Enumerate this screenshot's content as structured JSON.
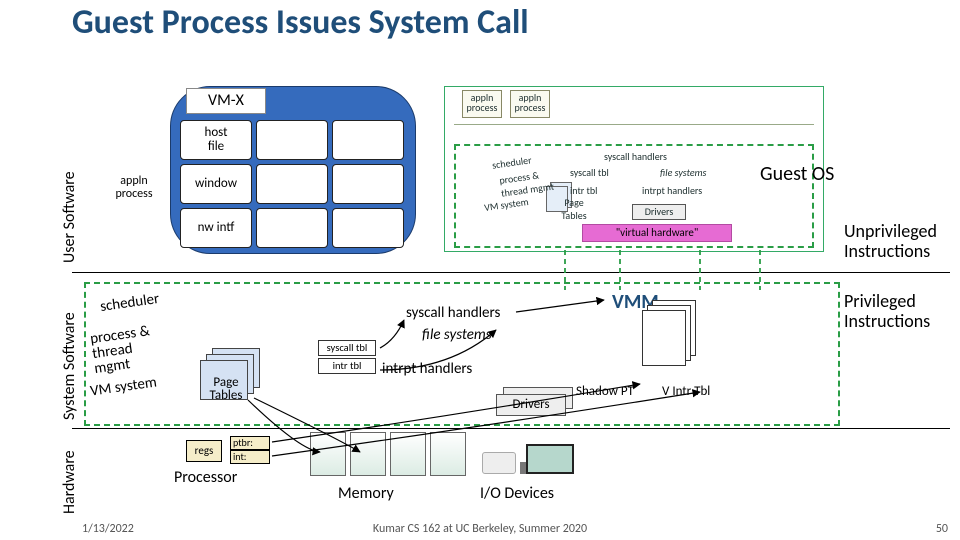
{
  "title": "Guest Process Issues System Call",
  "axis": {
    "user": "User Software",
    "system": "System Software",
    "hardware": "Hardware"
  },
  "user": {
    "appln": "appln\nprocess",
    "vmx": "VM-X",
    "cells": [
      "host file",
      "",
      "",
      "window",
      "",
      "",
      "nw intf",
      "",
      ""
    ]
  },
  "guest": {
    "title": "Guest OS",
    "appln": "appln process",
    "scheduler": "scheduler",
    "ptm": "process & thread mgmt",
    "vmsys": "VM system",
    "pt": "Page Tables",
    "sh": "syscall handlers",
    "st": "syscall tbl",
    "it": "intr tbl",
    "fs": "file systems",
    "ih": "intrpt handlers",
    "drivers": "Drivers",
    "vh": "\"virtual hardware\""
  },
  "sys": {
    "scheduler": "scheduler",
    "ptm": "process & thread mgmt",
    "vmsys": "VM system",
    "pt": "Page Tables",
    "st": "syscall tbl",
    "it": "intr tbl",
    "sh": "syscall handlers",
    "fs": "file systems",
    "ih": "intrpt handlers",
    "drivers": "Drivers",
    "vmm": "VMM",
    "spt": "Shadow PT",
    "vintr": "V Intr Tbl"
  },
  "hw": {
    "regs": "regs",
    "ptbr": "ptbr:",
    "int": "int:",
    "proc": "Processor",
    "mem": "Memory",
    "io": "I/O Devices"
  },
  "anno": {
    "unpriv": "Unprivileged Instructions",
    "priv": "Privileged Instructions"
  },
  "footer": {
    "date": "1/13/2022",
    "center": "Kumar CS 162 at UC Berkeley, Summer 2020",
    "page": "50"
  }
}
